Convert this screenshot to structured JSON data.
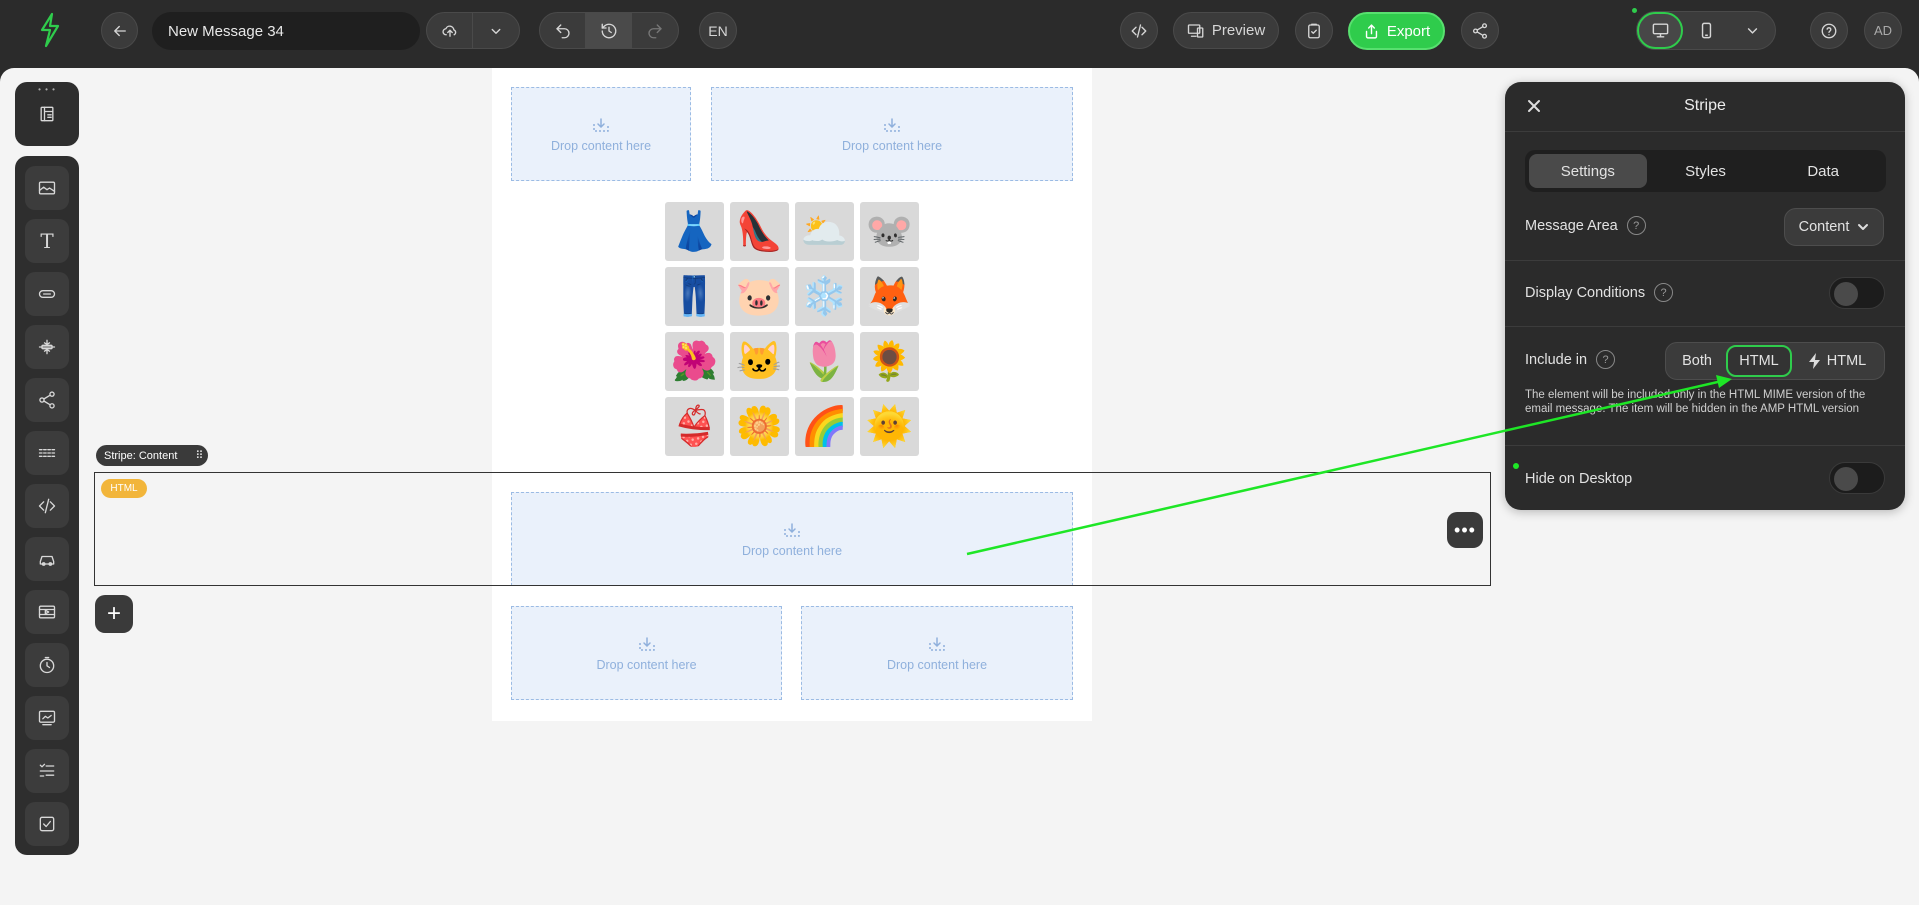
{
  "header": {
    "message_title": "New Message 34",
    "language": "EN",
    "preview_label": "Preview",
    "export_label": "Export",
    "avatar_initials": "AD"
  },
  "canvas": {
    "drop_label": "Drop content here",
    "stripe_tag": "Stripe: Content",
    "html_badge": "HTML",
    "emojis": [
      "👗",
      "👠",
      "🌥️",
      "🐭",
      "👖",
      "🐷",
      "❄️",
      "🦊",
      "🌺",
      "🐱",
      "🌷",
      "🌻",
      "👙",
      "🌼",
      "🌈",
      "🌞"
    ]
  },
  "panel": {
    "title": "Stripe",
    "tabs": [
      "Settings",
      "Styles",
      "Data"
    ],
    "message_area": {
      "label": "Message Area",
      "value": "Content"
    },
    "display_conditions": {
      "label": "Display Conditions",
      "enabled": false
    },
    "include_in": {
      "label": "Include in",
      "options": [
        "Both",
        "HTML",
        "HTML"
      ],
      "selected": "HTML"
    },
    "description": "The element will be included only in the HTML MIME version of the email message. The item will be hidden in the AMP HTML version",
    "hide_on_desktop": {
      "label": "Hide on Desktop",
      "enabled": false
    }
  },
  "colors": {
    "accent_green": "#2fcc4c",
    "html_badge": "#f2b53a",
    "drop_zone_border": "#9bbbe4"
  },
  "icons": [
    "logo-icon",
    "back-arrow-icon",
    "cloud-upload-icon",
    "chevron-down-icon",
    "undo-icon",
    "history-icon",
    "redo-icon",
    "code-icon",
    "preview-icon",
    "clipboard-check-icon",
    "export-icon",
    "share-icon",
    "desktop-icon",
    "mobile-icon",
    "help-icon",
    "close-icon"
  ]
}
